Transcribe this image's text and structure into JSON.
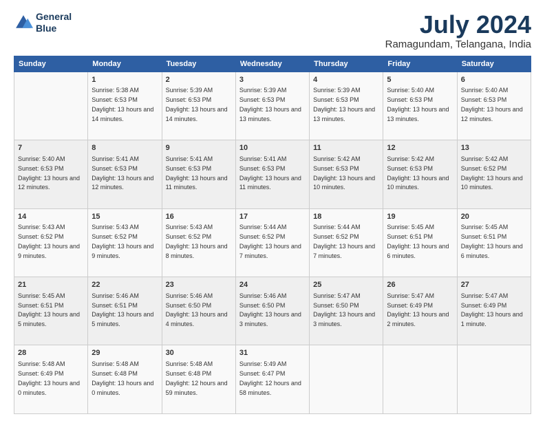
{
  "logo": {
    "line1": "General",
    "line2": "Blue"
  },
  "title": "July 2024",
  "subtitle": "Ramagundam, Telangana, India",
  "days_of_week": [
    "Sunday",
    "Monday",
    "Tuesday",
    "Wednesday",
    "Thursday",
    "Friday",
    "Saturday"
  ],
  "weeks": [
    [
      {
        "day": "",
        "sunrise": "",
        "sunset": "",
        "daylight": ""
      },
      {
        "day": "1",
        "sunrise": "Sunrise: 5:38 AM",
        "sunset": "Sunset: 6:53 PM",
        "daylight": "Daylight: 13 hours and 14 minutes."
      },
      {
        "day": "2",
        "sunrise": "Sunrise: 5:39 AM",
        "sunset": "Sunset: 6:53 PM",
        "daylight": "Daylight: 13 hours and 14 minutes."
      },
      {
        "day": "3",
        "sunrise": "Sunrise: 5:39 AM",
        "sunset": "Sunset: 6:53 PM",
        "daylight": "Daylight: 13 hours and 13 minutes."
      },
      {
        "day": "4",
        "sunrise": "Sunrise: 5:39 AM",
        "sunset": "Sunset: 6:53 PM",
        "daylight": "Daylight: 13 hours and 13 minutes."
      },
      {
        "day": "5",
        "sunrise": "Sunrise: 5:40 AM",
        "sunset": "Sunset: 6:53 PM",
        "daylight": "Daylight: 13 hours and 13 minutes."
      },
      {
        "day": "6",
        "sunrise": "Sunrise: 5:40 AM",
        "sunset": "Sunset: 6:53 PM",
        "daylight": "Daylight: 13 hours and 12 minutes."
      }
    ],
    [
      {
        "day": "7",
        "sunrise": "Sunrise: 5:40 AM",
        "sunset": "Sunset: 6:53 PM",
        "daylight": "Daylight: 13 hours and 12 minutes."
      },
      {
        "day": "8",
        "sunrise": "Sunrise: 5:41 AM",
        "sunset": "Sunset: 6:53 PM",
        "daylight": "Daylight: 13 hours and 12 minutes."
      },
      {
        "day": "9",
        "sunrise": "Sunrise: 5:41 AM",
        "sunset": "Sunset: 6:53 PM",
        "daylight": "Daylight: 13 hours and 11 minutes."
      },
      {
        "day": "10",
        "sunrise": "Sunrise: 5:41 AM",
        "sunset": "Sunset: 6:53 PM",
        "daylight": "Daylight: 13 hours and 11 minutes."
      },
      {
        "day": "11",
        "sunrise": "Sunrise: 5:42 AM",
        "sunset": "Sunset: 6:53 PM",
        "daylight": "Daylight: 13 hours and 10 minutes."
      },
      {
        "day": "12",
        "sunrise": "Sunrise: 5:42 AM",
        "sunset": "Sunset: 6:53 PM",
        "daylight": "Daylight: 13 hours and 10 minutes."
      },
      {
        "day": "13",
        "sunrise": "Sunrise: 5:42 AM",
        "sunset": "Sunset: 6:52 PM",
        "daylight": "Daylight: 13 hours and 10 minutes."
      }
    ],
    [
      {
        "day": "14",
        "sunrise": "Sunrise: 5:43 AM",
        "sunset": "Sunset: 6:52 PM",
        "daylight": "Daylight: 13 hours and 9 minutes."
      },
      {
        "day": "15",
        "sunrise": "Sunrise: 5:43 AM",
        "sunset": "Sunset: 6:52 PM",
        "daylight": "Daylight: 13 hours and 9 minutes."
      },
      {
        "day": "16",
        "sunrise": "Sunrise: 5:43 AM",
        "sunset": "Sunset: 6:52 PM",
        "daylight": "Daylight: 13 hours and 8 minutes."
      },
      {
        "day": "17",
        "sunrise": "Sunrise: 5:44 AM",
        "sunset": "Sunset: 6:52 PM",
        "daylight": "Daylight: 13 hours and 7 minutes."
      },
      {
        "day": "18",
        "sunrise": "Sunrise: 5:44 AM",
        "sunset": "Sunset: 6:52 PM",
        "daylight": "Daylight: 13 hours and 7 minutes."
      },
      {
        "day": "19",
        "sunrise": "Sunrise: 5:45 AM",
        "sunset": "Sunset: 6:51 PM",
        "daylight": "Daylight: 13 hours and 6 minutes."
      },
      {
        "day": "20",
        "sunrise": "Sunrise: 5:45 AM",
        "sunset": "Sunset: 6:51 PM",
        "daylight": "Daylight: 13 hours and 6 minutes."
      }
    ],
    [
      {
        "day": "21",
        "sunrise": "Sunrise: 5:45 AM",
        "sunset": "Sunset: 6:51 PM",
        "daylight": "Daylight: 13 hours and 5 minutes."
      },
      {
        "day": "22",
        "sunrise": "Sunrise: 5:46 AM",
        "sunset": "Sunset: 6:51 PM",
        "daylight": "Daylight: 13 hours and 5 minutes."
      },
      {
        "day": "23",
        "sunrise": "Sunrise: 5:46 AM",
        "sunset": "Sunset: 6:50 PM",
        "daylight": "Daylight: 13 hours and 4 minutes."
      },
      {
        "day": "24",
        "sunrise": "Sunrise: 5:46 AM",
        "sunset": "Sunset: 6:50 PM",
        "daylight": "Daylight: 13 hours and 3 minutes."
      },
      {
        "day": "25",
        "sunrise": "Sunrise: 5:47 AM",
        "sunset": "Sunset: 6:50 PM",
        "daylight": "Daylight: 13 hours and 3 minutes."
      },
      {
        "day": "26",
        "sunrise": "Sunrise: 5:47 AM",
        "sunset": "Sunset: 6:49 PM",
        "daylight": "Daylight: 13 hours and 2 minutes."
      },
      {
        "day": "27",
        "sunrise": "Sunrise: 5:47 AM",
        "sunset": "Sunset: 6:49 PM",
        "daylight": "Daylight: 13 hours and 1 minute."
      }
    ],
    [
      {
        "day": "28",
        "sunrise": "Sunrise: 5:48 AM",
        "sunset": "Sunset: 6:49 PM",
        "daylight": "Daylight: 13 hours and 0 minutes."
      },
      {
        "day": "29",
        "sunrise": "Sunrise: 5:48 AM",
        "sunset": "Sunset: 6:48 PM",
        "daylight": "Daylight: 13 hours and 0 minutes."
      },
      {
        "day": "30",
        "sunrise": "Sunrise: 5:48 AM",
        "sunset": "Sunset: 6:48 PM",
        "daylight": "Daylight: 12 hours and 59 minutes."
      },
      {
        "day": "31",
        "sunrise": "Sunrise: 5:49 AM",
        "sunset": "Sunset: 6:47 PM",
        "daylight": "Daylight: 12 hours and 58 minutes."
      },
      {
        "day": "",
        "sunrise": "",
        "sunset": "",
        "daylight": ""
      },
      {
        "day": "",
        "sunrise": "",
        "sunset": "",
        "daylight": ""
      },
      {
        "day": "",
        "sunrise": "",
        "sunset": "",
        "daylight": ""
      }
    ]
  ]
}
